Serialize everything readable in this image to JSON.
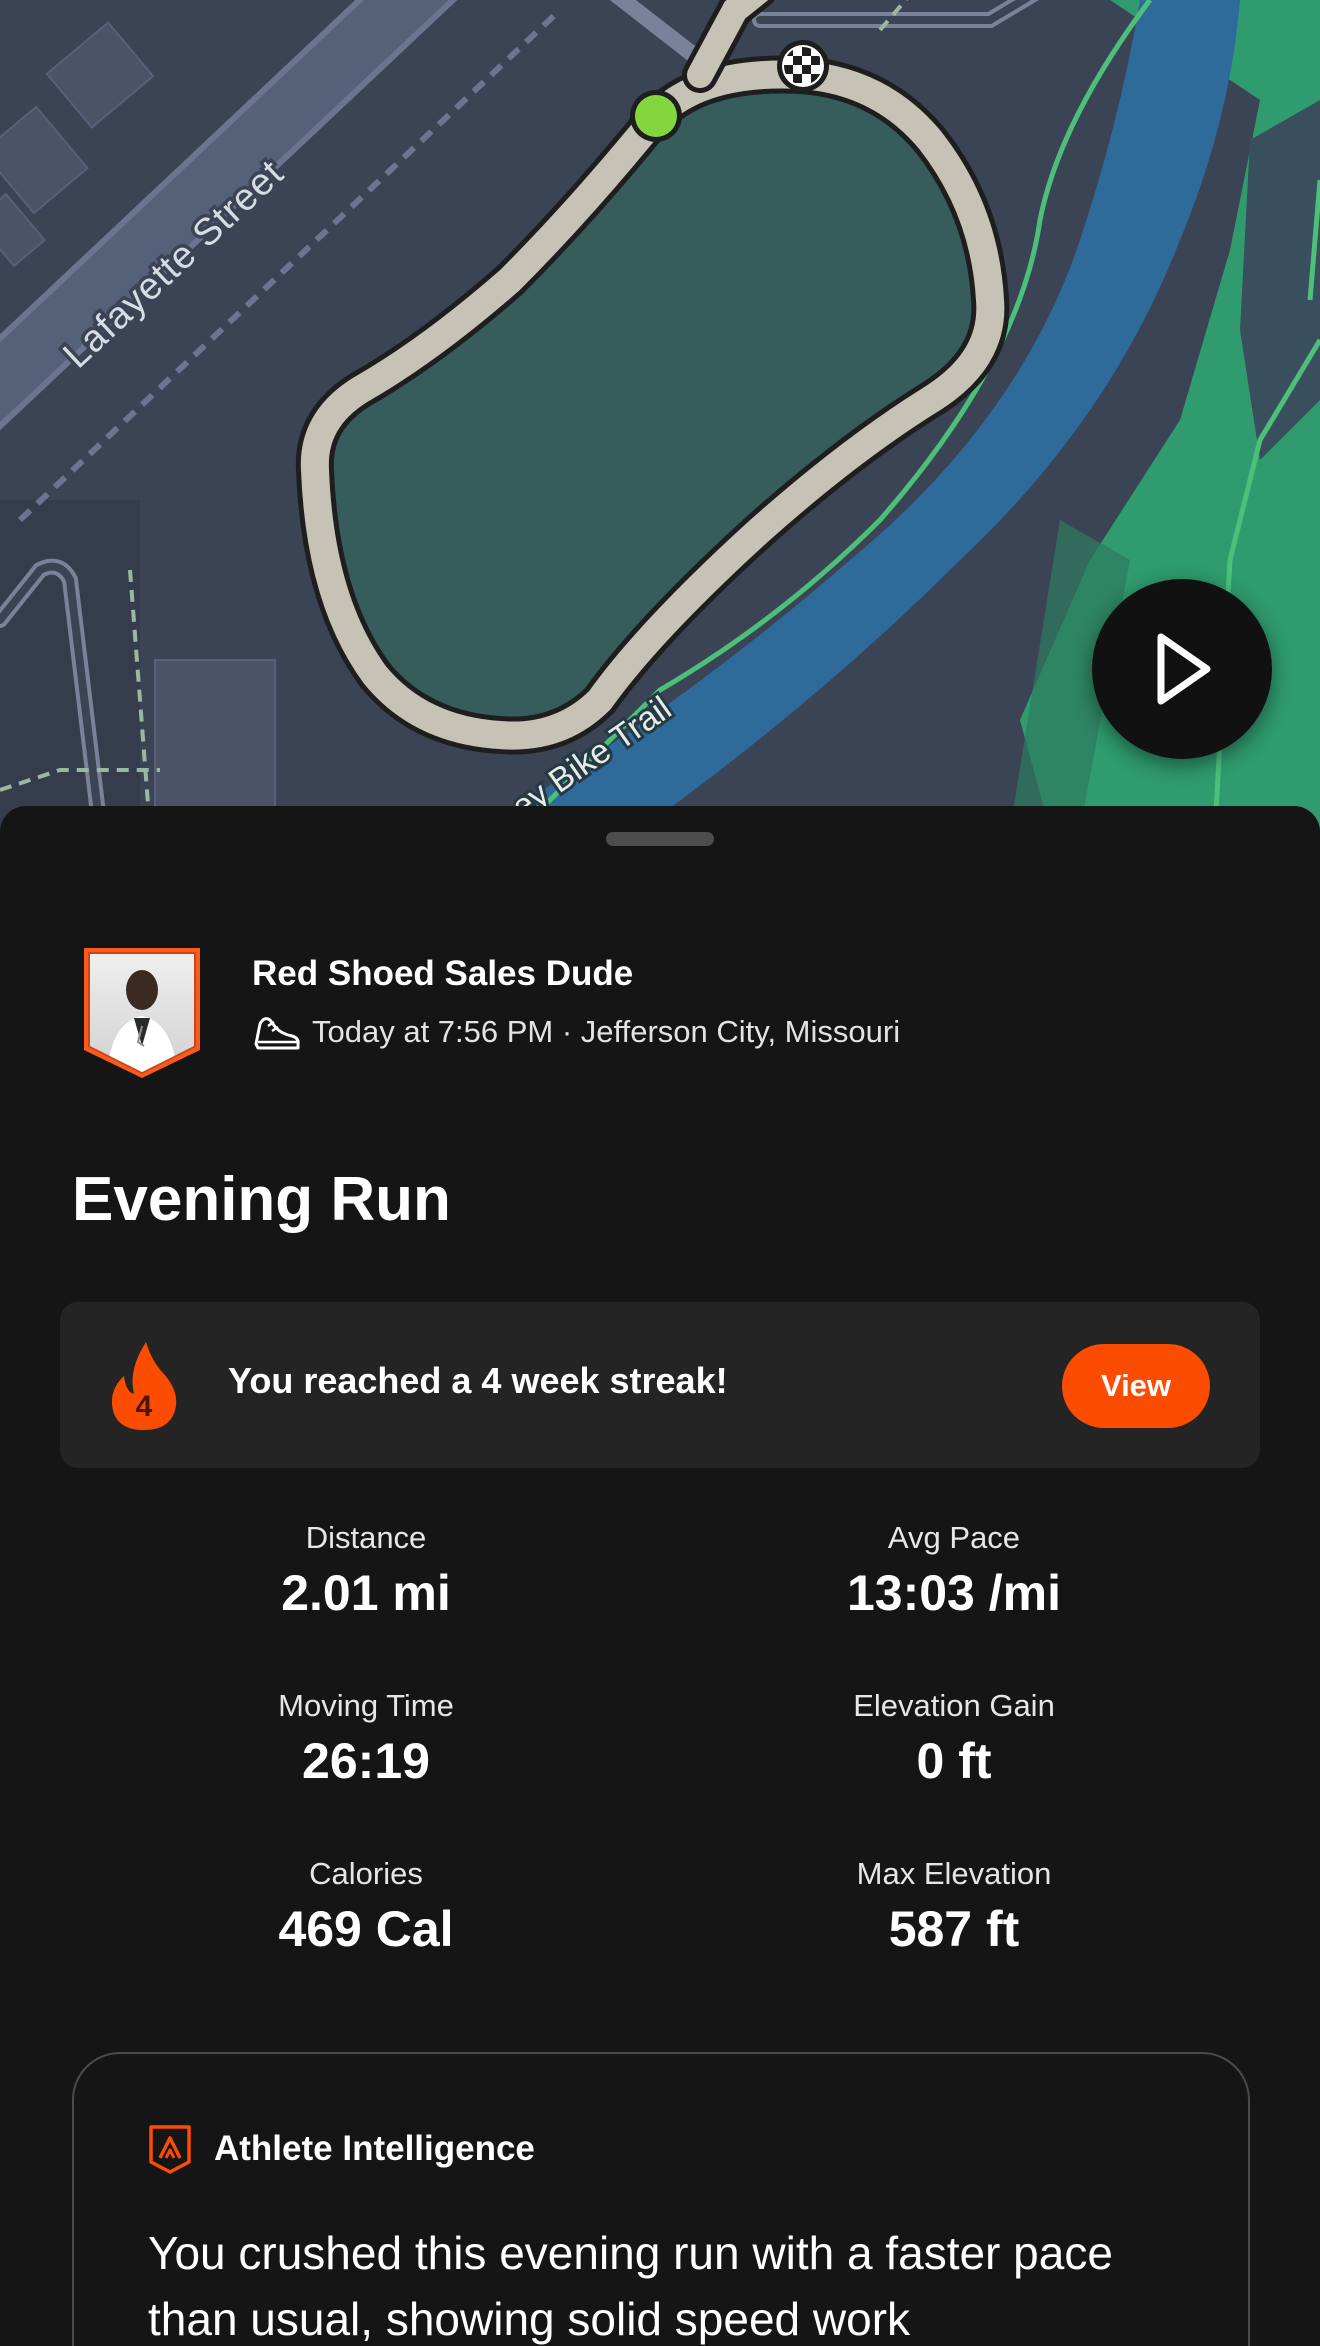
{
  "map": {
    "street_label": "Lafayette Street",
    "trail_label": "ey Bike Trail",
    "colors": {
      "background": "#3b4455",
      "park_fill": "#375c5c",
      "route_outline": "#c6c2b6",
      "river": "#2f6b9a",
      "greenway": "#2f9b6e",
      "trail_line": "#4cc07a",
      "start_marker": "#84d63e"
    },
    "start_marker_icon": "start-marker-icon",
    "finish_marker_icon": "checkered-flag-icon",
    "play_icon": "play-icon"
  },
  "athlete": {
    "name": "Red Shoed Sales Dude",
    "meta": "Today at 7:56 PM · Jefferson City, Missouri",
    "sport_icon": "running-shoe-icon"
  },
  "activity": {
    "title": "Evening Run"
  },
  "streak": {
    "text": "You reached a 4 week streak!",
    "count": "4",
    "button_label": "View",
    "accent_color": "#fc4c02"
  },
  "stats": [
    {
      "label": "Distance",
      "value": "2.01 mi"
    },
    {
      "label": "Avg Pace",
      "value": "13:03 /mi"
    },
    {
      "label": "Moving Time",
      "value": "26:19"
    },
    {
      "label": "Elevation Gain",
      "value": "0 ft"
    },
    {
      "label": "Calories",
      "value": "469 Cal"
    },
    {
      "label": "Max Elevation",
      "value": "587 ft"
    }
  ],
  "athlete_intelligence": {
    "title": "Athlete Intelligence",
    "body": "You crushed this evening run with a faster pace than usual, showing solid speed work"
  }
}
